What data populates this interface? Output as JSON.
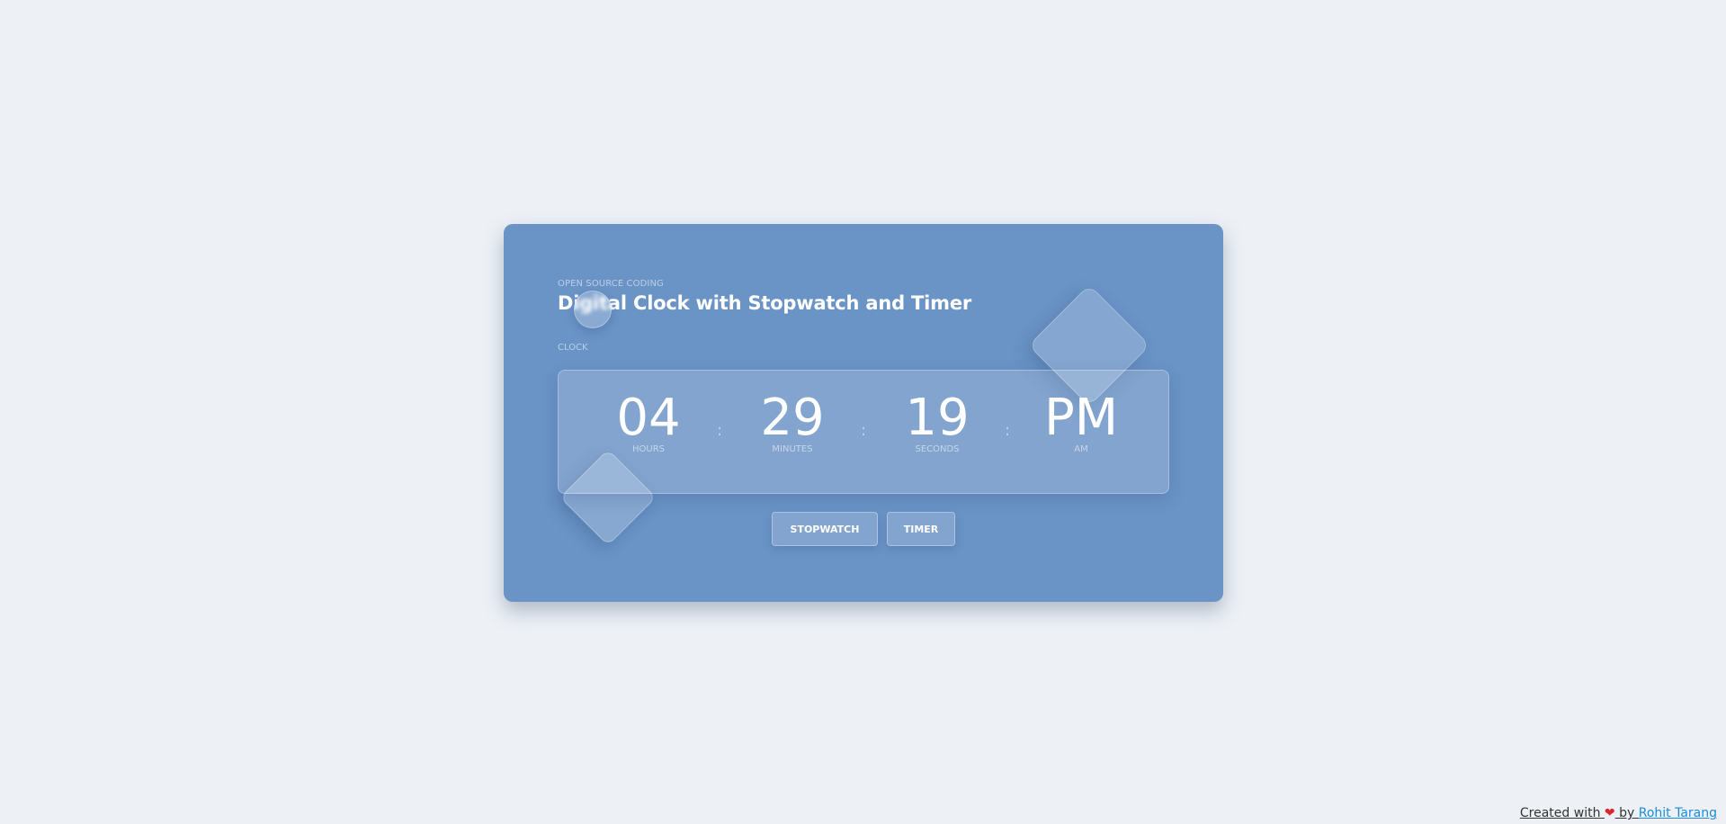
{
  "card": {
    "eyebrow": "OPEN SOURCE CODING",
    "title": "Digital Clock with Stopwatch and Timer",
    "section_label": "CLOCK"
  },
  "clock": {
    "hours": {
      "value": "04",
      "label": "HOURS"
    },
    "minutes": {
      "value": "29",
      "label": "MINUTES"
    },
    "seconds": {
      "value": "19",
      "label": "SECONDS"
    },
    "period": {
      "value": "PM",
      "label": "AM"
    },
    "separator": ":"
  },
  "buttons": {
    "stopwatch": "STOPWATCH",
    "timer": "TIMER"
  },
  "footer": {
    "prefix": "Created with",
    "heart_icon": "heart-icon",
    "by": "by",
    "author": "Rohit Tarang"
  },
  "colors": {
    "background": "#edf1f6",
    "card": "#6a93c6",
    "text": "#ffffff",
    "heart": "#e0242b",
    "link": "#1a8cd8"
  }
}
